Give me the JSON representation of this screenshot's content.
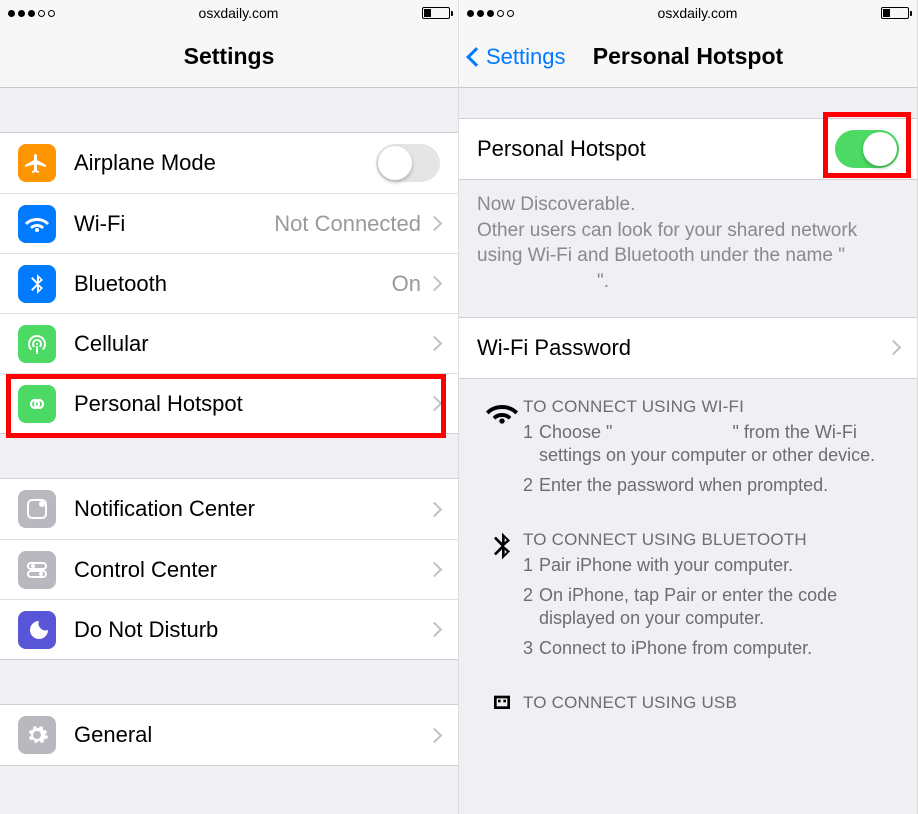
{
  "status": {
    "url": "osxdaily.com"
  },
  "left": {
    "title": "Settings",
    "rows": {
      "airplane": {
        "label": "Airplane Mode",
        "on": false
      },
      "wifi": {
        "label": "Wi-Fi",
        "detail": "Not Connected"
      },
      "bluetooth": {
        "label": "Bluetooth",
        "detail": "On"
      },
      "cellular": {
        "label": "Cellular"
      },
      "hotspot": {
        "label": "Personal Hotspot"
      },
      "notif": {
        "label": "Notification Center"
      },
      "cc": {
        "label": "Control Center"
      },
      "dnd": {
        "label": "Do Not Disturb"
      },
      "general": {
        "label": "General"
      }
    }
  },
  "right": {
    "back": "Settings",
    "title": "Personal Hotspot",
    "toggle": {
      "label": "Personal Hotspot",
      "on": true
    },
    "discover1": "Now Discoverable.",
    "discover2a": "Other users can look for your shared network using Wi-Fi and Bluetooth under the name \"",
    "discover2b": "\".",
    "wifi_pw": {
      "label": "Wi-Fi Password"
    },
    "wifi": {
      "hdr": "TO CONNECT USING WI-FI",
      "s1a": "Choose \"",
      "s1b": "\" from the Wi-Fi settings on your computer or other device.",
      "s2": "Enter the password when prompted."
    },
    "bt": {
      "hdr": "TO CONNECT USING BLUETOOTH",
      "s1": "Pair iPhone with your computer.",
      "s2": "On iPhone, tap Pair or enter the code displayed on your computer.",
      "s3": "Connect to iPhone from computer."
    },
    "usb": {
      "hdr": "TO CONNECT USING USB"
    }
  }
}
